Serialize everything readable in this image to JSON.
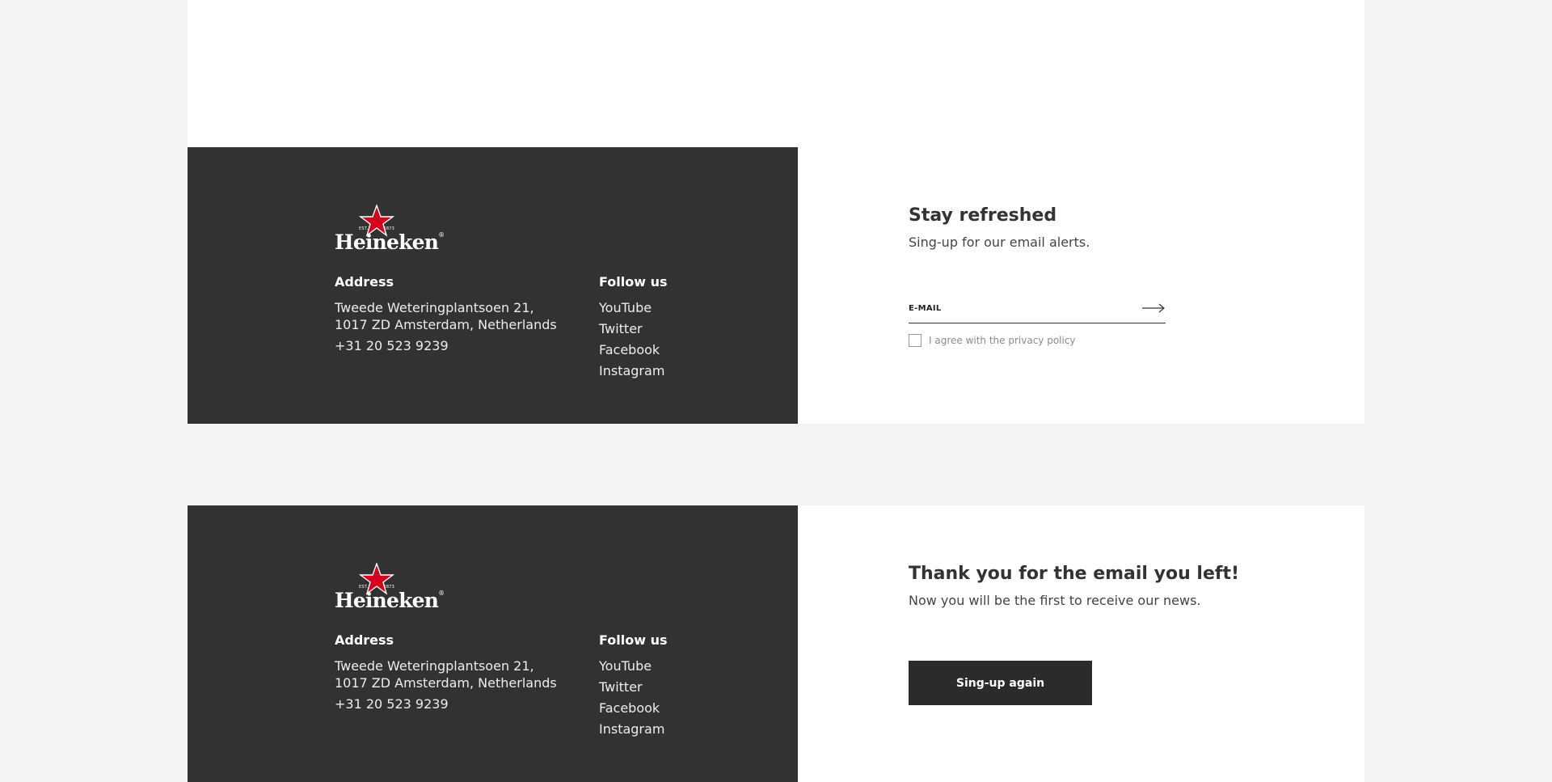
{
  "brand": {
    "name": "Heineken",
    "registered_mark": "®",
    "est_left": "EST.",
    "est_right": "1873",
    "star_color": "#d6001c"
  },
  "footer": {
    "address_heading": "Address",
    "address_line1": "Tweede Weteringplantsoen 21,",
    "address_line2": "1017 ZD Amsterdam, Netherlands",
    "phone": "+31 20 523 9239",
    "follow_heading": "Follow us",
    "social_links": [
      "YouTube",
      "Twitter",
      "Facebook",
      "Instagram"
    ]
  },
  "signup": {
    "title": "Stay refreshed",
    "subtitle": "Sing-up for our email alerts.",
    "email_placeholder": "E-MAIL",
    "consent_label": "I agree with the privacy policy"
  },
  "thanks": {
    "title": "Thank you for the email you left!",
    "subtitle": "Now you will be the first to receive our news.",
    "button_label": "Sing-up again"
  },
  "colors": {
    "dark_panel": "#323232",
    "button": "#2b2b2b",
    "page_bg": "#f3f3f3"
  }
}
